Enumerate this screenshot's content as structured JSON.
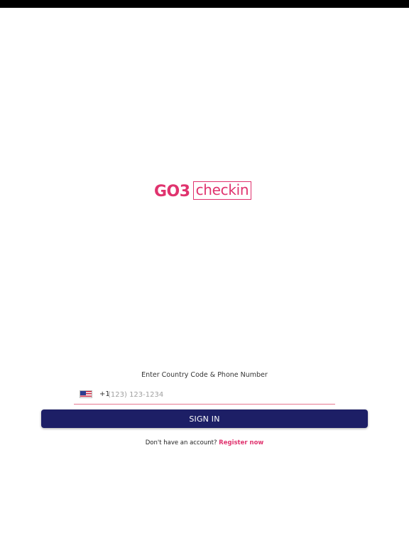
{
  "logo": {
    "part1": "GO3",
    "part2": "checkin"
  },
  "login": {
    "phone_label": "Enter Country Code & Phone Number",
    "country_flag": "us-flag-icon",
    "dial_code": "+1",
    "phone_value": "",
    "phone_placeholder": "(123) 123-1234",
    "signin_label": "SIGN IN",
    "register_prompt": "Don't have an account?",
    "register_link": "Register now"
  },
  "colors": {
    "brand_pink": "#e0336e",
    "button_navy": "#1d1f66",
    "input_underline": "#e7778f"
  }
}
